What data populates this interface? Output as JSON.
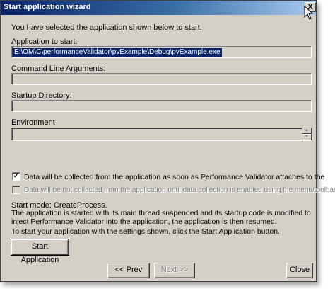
{
  "window": {
    "title": "Start application wizard",
    "close_glyph": "X"
  },
  "intro": "You have selected the application shown below to start.",
  "app_to_start": {
    "label": "Application to start:",
    "value": "E:\\OM\\C\\performanceValidator\\pvExample\\Debug\\pvExample.exe"
  },
  "command_line": {
    "label": "Command Line Arguments:",
    "value": ""
  },
  "startup_dir": {
    "label": "Startup Directory:",
    "value": ""
  },
  "environment": {
    "label": "Environment",
    "value": "",
    "spin_up": "▲",
    "spin_down": "▼"
  },
  "options": {
    "collect_on_attach": {
      "label": "Data will be collected from the application as soon as Performance Validator attaches to the",
      "checked": true,
      "check_glyph": "✓"
    },
    "collect_on_enable": {
      "label": "Data will be not collected from the application until data collection is enabled using the menu/toolbar.",
      "checked": false
    }
  },
  "start_mode": {
    "heading": "Start mode: CreateProcess.",
    "description": "The application is started with its main thread suspended and its startup code is modified to inject Performance Validator into the application, the application is then resumed."
  },
  "instructions": "To start your application with the settings shown, click the Start Application button.",
  "buttons": {
    "start_application": "Start Application",
    "prev": "<< Prev",
    "next": "Next >>",
    "close": "Close"
  }
}
